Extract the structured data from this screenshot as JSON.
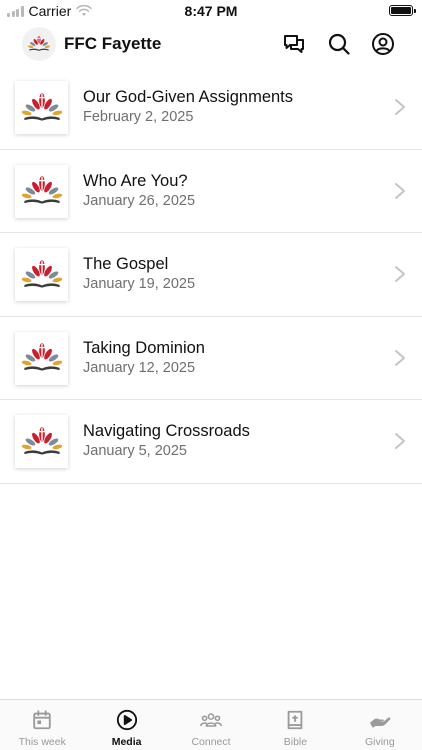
{
  "status_bar": {
    "carrier": "Carrier",
    "time": "8:47 PM"
  },
  "header": {
    "title": "FFC Fayette",
    "actions": [
      {
        "name": "chat-icon"
      },
      {
        "name": "search-icon"
      },
      {
        "name": "account-icon"
      }
    ]
  },
  "sermons": [
    {
      "title": "Our God-Given Assignments",
      "date": "February 2, 2025"
    },
    {
      "title": "Who Are You?",
      "date": "January 26, 2025"
    },
    {
      "title": "The Gospel",
      "date": "January 19, 2025"
    },
    {
      "title": "Taking Dominion",
      "date": "January 12, 2025"
    },
    {
      "title": "Navigating Crossroads",
      "date": "January 5, 2025"
    }
  ],
  "tabs": [
    {
      "label": "This week",
      "icon": "calendar-icon",
      "active": false
    },
    {
      "label": "Media",
      "icon": "play-icon",
      "active": true
    },
    {
      "label": "Connect",
      "icon": "people-icon",
      "active": false
    },
    {
      "label": "Bible",
      "icon": "bible-icon",
      "active": false
    },
    {
      "label": "Giving",
      "icon": "giving-hand-icon",
      "active": false
    }
  ],
  "colors": {
    "accent": "#111111",
    "inactive_tab": "#9a9a9a",
    "logo_red": "#c8202e",
    "logo_gold": "#e0a52b",
    "logo_slate": "#7d8a9a"
  }
}
